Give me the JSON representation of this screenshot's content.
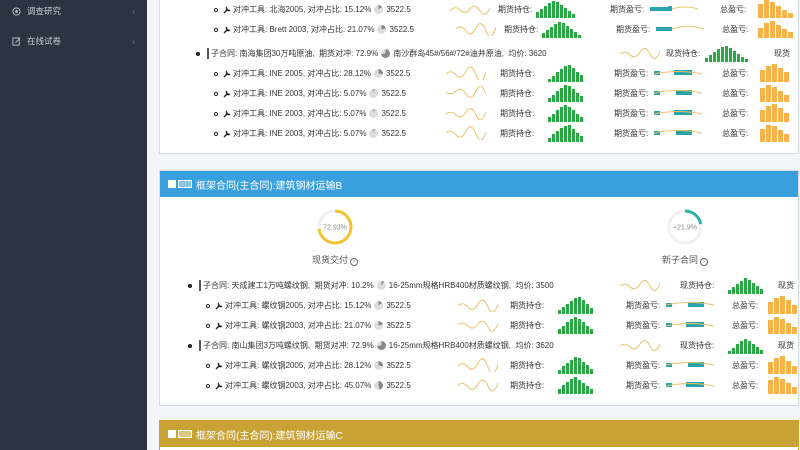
{
  "sidebar": {
    "items": [
      {
        "label": "调查研究",
        "icon": "survey-icon"
      },
      {
        "label": "在线试卷",
        "icon": "edit-icon"
      }
    ]
  },
  "labels": {
    "hedge_tool": "对冲工具:",
    "hedge_ratio": "对冲占比:",
    "futures_holding": "期货持仓:",
    "futures_pnl": "期货盈亏:",
    "total_pnl": "总盈亏:",
    "spot_holding": "现货持仓:",
    "value": "3522.5"
  },
  "panel_a": {
    "rows_top": [
      {
        "tool": "北海2005",
        "ratio": "15.12%"
      },
      {
        "tool": "Brett 2003",
        "ratio": "21.07%"
      }
    ],
    "subcontract": {
      "name": "南海集团30万吨原油",
      "ratio": "72.9%",
      "product": "南沙群岛45#/56#/72#油井原油",
      "price": "均价: 3620"
    },
    "rows_bottom": [
      {
        "tool": "INE 2005",
        "ratio": "28.12%"
      },
      {
        "tool": "INE 2003",
        "ratio": "5.07%"
      },
      {
        "tool": "INE 2003",
        "ratio": "5.07%"
      },
      {
        "tool": "INE 2003",
        "ratio": "5.07%"
      }
    ]
  },
  "panel_b": {
    "title": "框架合同(主合同):建筑钢材运输B",
    "gauges": [
      {
        "value": "72.93%",
        "label": "现货交付",
        "fraction": 0.7293,
        "color": "#f2c230"
      },
      {
        "value": "+21.9%",
        "label": "新子合同",
        "fraction": 0.219,
        "color": "#2ab5a8"
      }
    ],
    "subcontracts": [
      {
        "name": "天成建工1万吨螺纹钢",
        "ratio": "10.2%",
        "product": "16-25mm规格HRB400材质螺纹钢",
        "price": "均价: 3500",
        "rows": [
          {
            "tool": "螺纹钢2005",
            "ratio": "15.12%"
          },
          {
            "tool": "螺纹钢2003",
            "ratio": "21.07%"
          }
        ]
      },
      {
        "name": "南山集团3万吨螺纹钢",
        "ratio": "72.9%",
        "product": "16-25mm规格HRB400材质螺纹钢",
        "price": "均价: 3620",
        "rows": [
          {
            "tool": "螺纹钢2005",
            "ratio": "28.12%"
          },
          {
            "tool": "螺纹钢2003",
            "ratio": "45.07%"
          }
        ]
      }
    ]
  },
  "panel_c": {
    "title": "框架合同(主合同):建筑钢材运输C"
  },
  "prefix": {
    "sub": "子合同:",
    "hedge_ratio_label": "期货对冲:"
  },
  "colors": {
    "panel_b_head": "#3a9fdd",
    "panel_c_head": "#c9a236",
    "bar": "#2aa845",
    "teal": "#2aa3a8",
    "orange": "#f8b24a",
    "sidebar": "#2b3440"
  }
}
